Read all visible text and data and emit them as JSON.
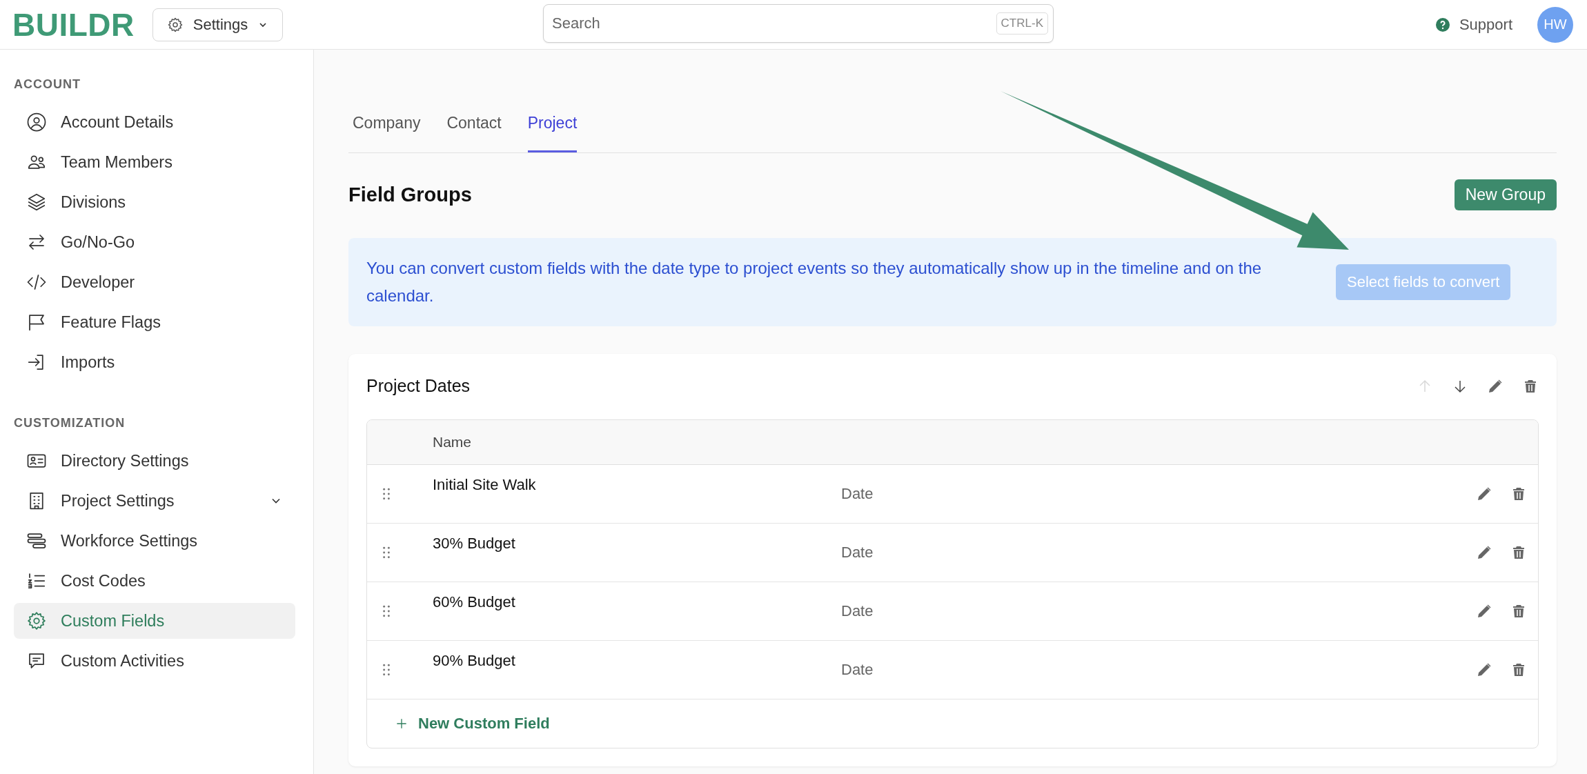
{
  "header": {
    "logo": "BUILDR",
    "menu_button": "Settings",
    "search": {
      "placeholder": "Search",
      "shortcut": "CTRL-K"
    },
    "support": "Support",
    "avatar": "HW"
  },
  "sidebar": {
    "sections": [
      {
        "heading": "ACCOUNT",
        "items": [
          {
            "label": "Account Details",
            "selected": false,
            "expandable": false
          },
          {
            "label": "Team Members",
            "selected": false,
            "expandable": false
          },
          {
            "label": "Divisions",
            "selected": false,
            "expandable": false
          },
          {
            "label": "Go/No-Go",
            "selected": false,
            "expandable": false
          },
          {
            "label": "Developer",
            "selected": false,
            "expandable": false
          },
          {
            "label": "Feature Flags",
            "selected": false,
            "expandable": false
          },
          {
            "label": "Imports",
            "selected": false,
            "expandable": false
          }
        ]
      },
      {
        "heading": "CUSTOMIZATION",
        "items": [
          {
            "label": "Directory Settings",
            "selected": false,
            "expandable": false
          },
          {
            "label": "Project Settings",
            "selected": false,
            "expandable": true
          },
          {
            "label": "Workforce Settings",
            "selected": false,
            "expandable": false
          },
          {
            "label": "Cost Codes",
            "selected": false,
            "expandable": false
          },
          {
            "label": "Custom Fields",
            "selected": true,
            "expandable": false
          },
          {
            "label": "Custom Activities",
            "selected": false,
            "expandable": false
          }
        ]
      }
    ]
  },
  "tabs": [
    {
      "label": "Company",
      "selected": false
    },
    {
      "label": "Contact",
      "selected": false
    },
    {
      "label": "Project",
      "selected": true
    }
  ],
  "title": "Field Groups",
  "new_group_button": "New Group",
  "notice": {
    "text": "You can convert custom fields with the date type to project events so they automatically show up in the timeline and on the calendar.",
    "button": "Select fields to convert",
    "button_disabled": true
  },
  "group": {
    "title": "Project Dates",
    "move_up_disabled": true,
    "move_down_disabled": false,
    "table": {
      "columns": [
        "Name"
      ],
      "rows": [
        {
          "name": "Initial Site Walk",
          "type": "Date"
        },
        {
          "name": "30% Budget",
          "type": "Date"
        },
        {
          "name": "60% Budget",
          "type": "Date"
        },
        {
          "name": "90% Budget",
          "type": "Date"
        }
      ]
    },
    "add_field": "New Custom Field"
  }
}
